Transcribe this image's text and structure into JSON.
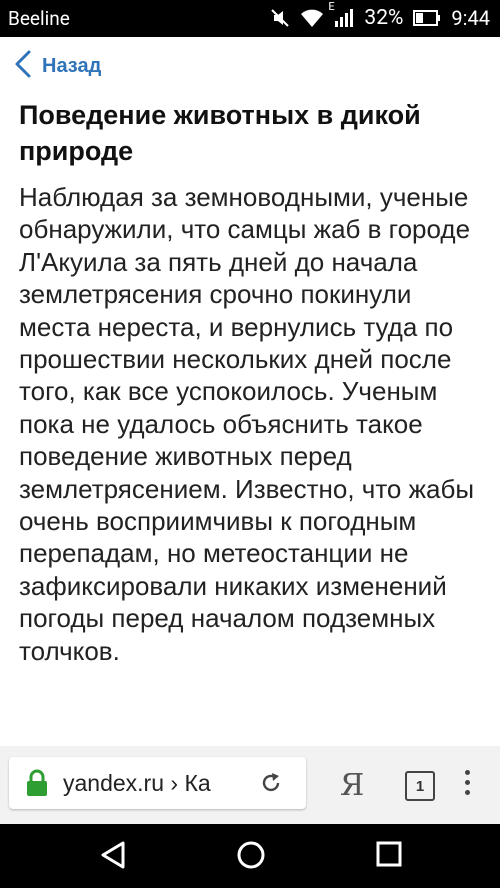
{
  "status_bar": {
    "carrier": "Beeline",
    "network": "E",
    "battery": "32%",
    "time": "9:44"
  },
  "app_bar": {
    "back_label": "Назад"
  },
  "article": {
    "title": "Поведение животных в дикой природе",
    "body": "Наблюдая за земноводными, ученые обнаружили, что самцы жаб в городе Л'Акуила за пять дней до начала землетрясения срочно покинули места нереста, и вернулись туда по прошествии нескольких дней после того, как все успокоилось. Ученым пока не удалось объяснить такое поведение животных перед землетрясением. Известно, что жабы очень восприимчивы к погодным перепадам, но метеостанции не зафиксировали никаких изменений погоды перед началом подземных толчков."
  },
  "browser": {
    "url": "yandex.ru › Ка",
    "yandex_button": "Я",
    "tab_count": "1"
  },
  "colors": {
    "link": "#2f73b8",
    "lock": "#2e9e33"
  },
  "icons": [
    "mute-icon",
    "wifi-icon",
    "signal-icon",
    "battery-icon",
    "back-chevron-icon",
    "lock-icon",
    "reload-icon",
    "tabs-icon",
    "menu-icon",
    "nav-back-icon",
    "nav-home-icon",
    "nav-recents-icon"
  ]
}
